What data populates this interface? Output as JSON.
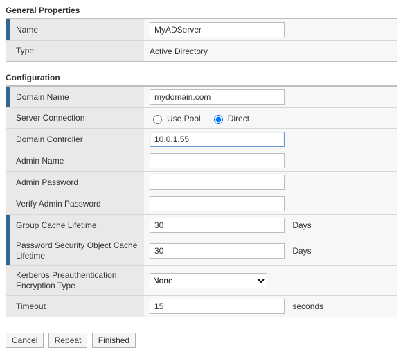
{
  "sections": {
    "general": "General Properties",
    "config": "Configuration"
  },
  "general": {
    "name_label": "Name",
    "name_value": "MyADServer",
    "type_label": "Type",
    "type_value": "Active Directory"
  },
  "config": {
    "domain_name_label": "Domain Name",
    "domain_name_value": "mydomain.com",
    "server_connection_label": "Server Connection",
    "server_connection_options": {
      "use_pool": "Use Pool",
      "direct": "Direct"
    },
    "server_connection_selected": "direct",
    "domain_controller_label": "Domain Controller",
    "domain_controller_value": "10.0.1.55",
    "admin_name_label": "Admin Name",
    "admin_name_value": "",
    "admin_password_label": "Admin Password",
    "admin_password_value": "",
    "verify_admin_password_label": "Verify Admin Password",
    "verify_admin_password_value": "",
    "group_cache_label": "Group Cache Lifetime",
    "group_cache_value": "30",
    "group_cache_unit": "Days",
    "psocl_label": "Password Security Object Cache Lifetime",
    "psocl_value": "30",
    "psocl_unit": "Days",
    "kerberos_label": "Kerberos Preauthentication Encryption Type",
    "kerberos_value": "None",
    "timeout_label": "Timeout",
    "timeout_value": "15",
    "timeout_unit": "seconds"
  },
  "buttons": {
    "cancel": "Cancel",
    "repeat": "Repeat",
    "finished": "Finished"
  }
}
